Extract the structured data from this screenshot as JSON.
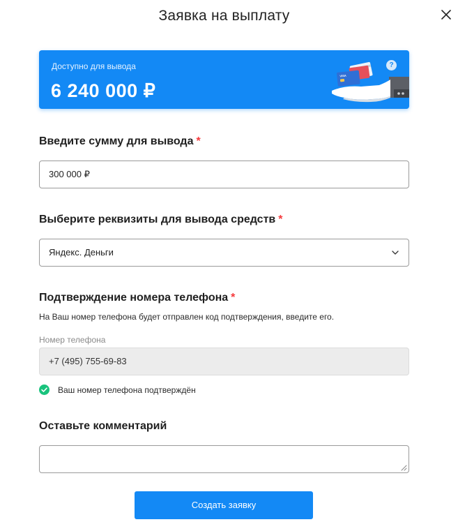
{
  "modal": {
    "title": "Заявка на выплату",
    "close_icon": "close-icon"
  },
  "balance": {
    "label": "Доступно для вывода",
    "amount": "6 240 000 ₽",
    "help_glyph": "?",
    "card_brand": "VISA",
    "accent_color": "#1389f5"
  },
  "amount_section": {
    "title": "Введите сумму для вывода",
    "required_mark": "*",
    "value": "300 000 ₽"
  },
  "requisites_section": {
    "title": "Выберите реквизиты для вывода средств",
    "required_mark": "*",
    "selected": "Яндекс. Деньги",
    "icon": "chevron-down-icon"
  },
  "phone_section": {
    "title": "Подтверждение номера телефона",
    "required_mark": "*",
    "hint": "На Ваш номер телефона будет отправлен код подтверждения, введите его.",
    "field_label": "Номер телефона",
    "value": "+7 (495) 755-69-83",
    "verified_text": "Ваш номер телефона подтверждён",
    "verified_color": "#19c37d"
  },
  "comment_section": {
    "title": "Оставьте комментарий",
    "value": ""
  },
  "submit": {
    "label": "Создать заявку"
  }
}
